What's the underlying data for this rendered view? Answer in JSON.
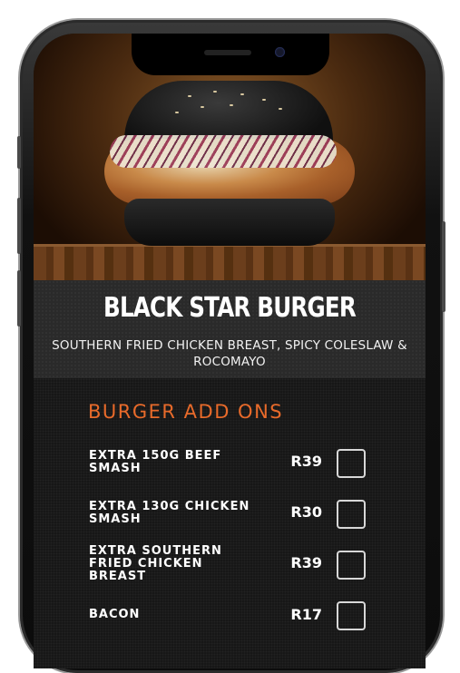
{
  "item": {
    "title": "BLACK STAR BURGER",
    "description": "SOUTHERN FRIED CHICKEN BREAST, SPICY COLESLAW & ROCOMAYO"
  },
  "addons": {
    "heading": "BURGER ADD ONS",
    "items": [
      {
        "name": "EXTRA 150G BEEF SMASH",
        "price": "R39",
        "checked": false
      },
      {
        "name": "EXTRA 130G CHICKEN SMASH",
        "price": "R30",
        "checked": false
      },
      {
        "name": "EXTRA SOUTHERN FRIED CHICKEN BREAST",
        "price": "R39",
        "checked": false
      },
      {
        "name": "BACON",
        "price": "R17",
        "checked": false
      }
    ]
  },
  "colors": {
    "accent": "#e86a2a",
    "background": "#171717",
    "title_band": "#2a2a2a",
    "text": "#ffffff"
  },
  "icons": {
    "checkbox": "checkbox-empty-icon",
    "hero": "burger-photo"
  }
}
